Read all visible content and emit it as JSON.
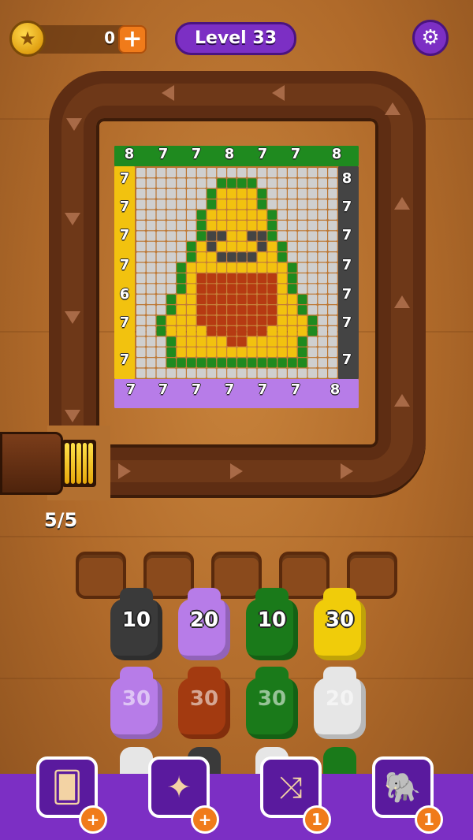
{
  "header": {
    "coins": "0",
    "coin_plus": "+",
    "level": "Level 33",
    "settings_icon": "gear-icon"
  },
  "shooter": {
    "ammo_count": "5/5"
  },
  "board": {
    "top_numbers": [
      "8",
      "7",
      "7",
      "8",
      "7",
      "7",
      "8"
    ],
    "left_numbers": [
      "7",
      "7",
      "7",
      "7",
      "6",
      "7",
      "7"
    ],
    "right_numbers": [
      "8",
      "7",
      "7",
      "7",
      "7",
      "7",
      "7"
    ],
    "bottom_numbers": [
      "7",
      "7",
      "7",
      "7",
      "7",
      "7",
      "8"
    ],
    "colors": {
      "green": "#1f8a1f",
      "yellow": "#f2c20f",
      "gray": "#cfcfcf",
      "dark": "#444444",
      "brown": "#b63a12",
      "purple": "#b77ce8"
    }
  },
  "spools": {
    "row1": [
      {
        "value": "10",
        "color": "#3a3a3a"
      },
      {
        "value": "20",
        "color": "#b77ce8"
      },
      {
        "value": "10",
        "color": "#1a7a1a"
      },
      {
        "value": "30",
        "color": "#f0cc0a"
      }
    ],
    "row2": [
      {
        "value": "30",
        "color": "#b77ce8"
      },
      {
        "value": "30",
        "color": "#a33a10"
      },
      {
        "value": "30",
        "color": "#1a7a1a"
      },
      {
        "value": "20",
        "color": "#e6e6e6"
      }
    ]
  },
  "boosters": [
    {
      "name": "add-slot",
      "icon": "cards-icon",
      "badge": "+"
    },
    {
      "name": "magic-wand",
      "icon": "wand-icon",
      "badge": "+"
    },
    {
      "name": "shuffle",
      "icon": "shuffle-icon",
      "badge": "1"
    },
    {
      "name": "elephant",
      "icon": "elephant-icon",
      "badge": "1"
    }
  ]
}
